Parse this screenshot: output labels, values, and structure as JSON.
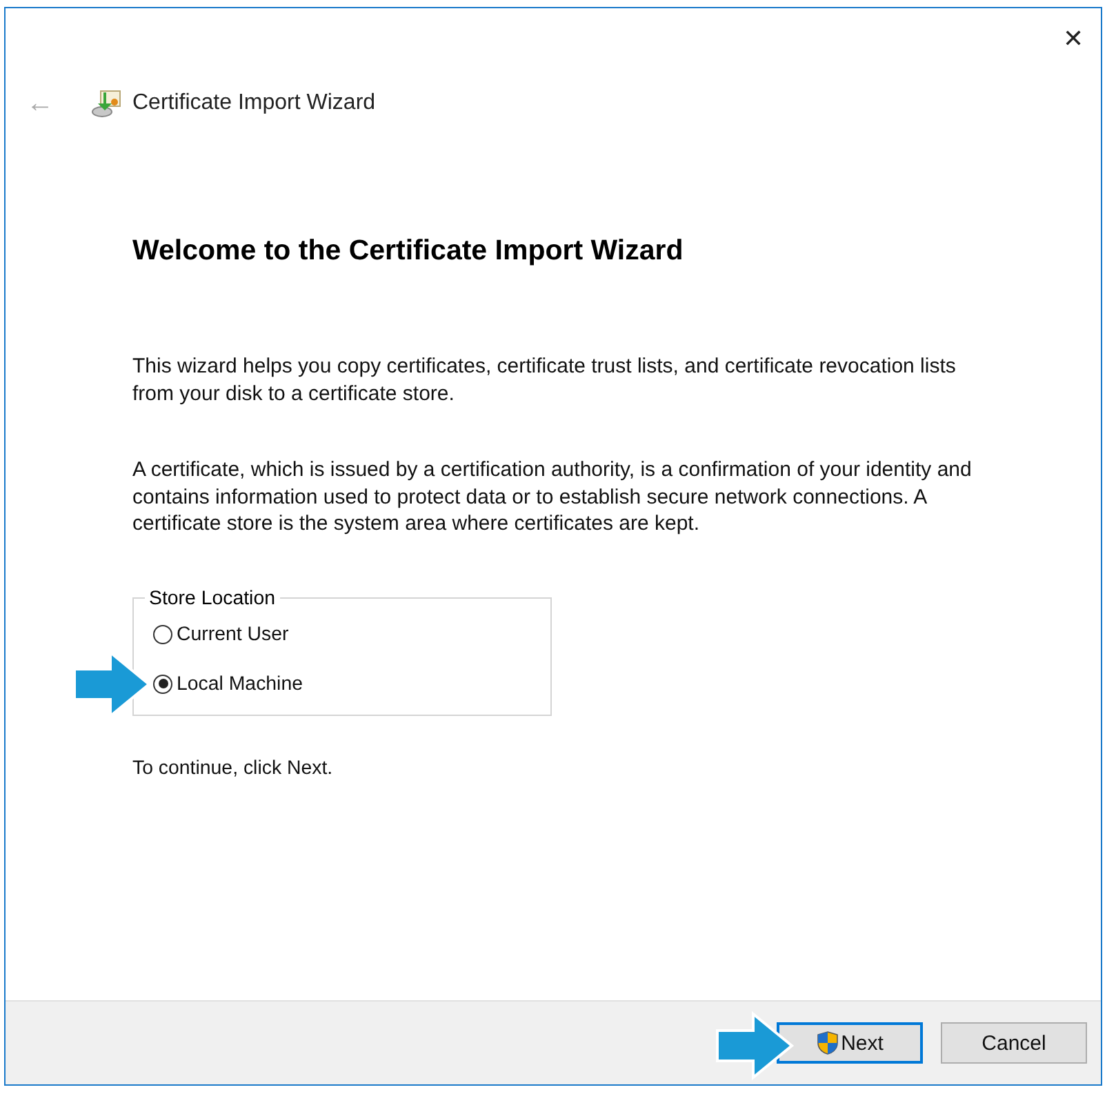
{
  "window": {
    "title": "Certificate Import Wizard",
    "close": "✕",
    "back": "←"
  },
  "heading": "Welcome to the Certificate Import Wizard",
  "paragraphs": [
    "This wizard helps you copy certificates, certificate trust lists, and certificate revocation lists from your disk to a certificate store.",
    "A certificate, which is issued by a certification authority, is a confirmation of your identity and contains information used to protect data or to establish secure network connections. A certificate store is the system area where certificates are kept."
  ],
  "store_location": {
    "label": "Store Location",
    "options": [
      {
        "label": "Current User",
        "selected": false
      },
      {
        "label": "Local Machine",
        "selected": true
      }
    ]
  },
  "hint": "To continue, click Next.",
  "buttons": [
    {
      "label": "Next",
      "kind": "shield",
      "default": true
    },
    {
      "label": "Cancel",
      "kind": "plain",
      "default": false
    }
  ]
}
